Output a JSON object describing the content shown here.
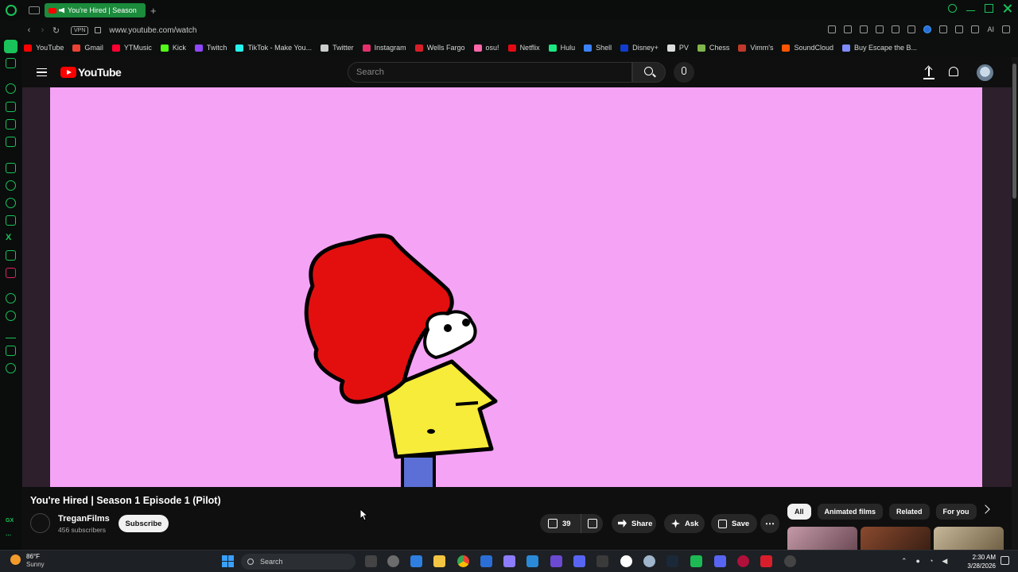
{
  "browser": {
    "tab_title": "You're Hired | Season",
    "url": "www.youtube.com/watch",
    "vpn_label": "VPN",
    "ai_label": "AI",
    "new_tab_symbol": "+"
  },
  "bookmarks": [
    {
      "label": "YouTube",
      "color": "#ff0000"
    },
    {
      "label": "Gmail",
      "color": "#ea4335"
    },
    {
      "label": "YTMusic",
      "color": "#ff0033"
    },
    {
      "label": "Kick",
      "color": "#53fc18"
    },
    {
      "label": "Twitch",
      "color": "#9146ff"
    },
    {
      "label": "TikTok - Make You...",
      "color": "#25f4ee"
    },
    {
      "label": "Twitter",
      "color": "#cccccc"
    },
    {
      "label": "Instagram",
      "color": "#e1306c"
    },
    {
      "label": "Wells Fargo",
      "color": "#d71e28"
    },
    {
      "label": "osu!",
      "color": "#ff66aa"
    },
    {
      "label": "Netflix",
      "color": "#e50914"
    },
    {
      "label": "Hulu",
      "color": "#1ce783"
    },
    {
      "label": "Shell",
      "color": "#3b82f6"
    },
    {
      "label": "Disney+",
      "color": "#113ccf"
    },
    {
      "label": "PV",
      "color": "#dddddd"
    },
    {
      "label": "Chess",
      "color": "#81b64c"
    },
    {
      "label": "Vimm's",
      "color": "#c0392b"
    },
    {
      "label": "SoundCloud",
      "color": "#ff5500"
    },
    {
      "label": "Buy Escape the B...",
      "color": "#7f8cff"
    }
  ],
  "youtube": {
    "logo_text": "YouTube",
    "search_placeholder": "Search"
  },
  "video": {
    "title": "You're Hired | Season 1 Episode 1 (Pilot)",
    "background_color": "#f5a3f5"
  },
  "channel": {
    "name": "TreganFilms",
    "subscribers": "456 subscribers",
    "subscribe_label": "Subscribe"
  },
  "actions": {
    "likes": "39",
    "share_label": "Share",
    "ask_label": "Ask",
    "save_label": "Save",
    "more_label": "⋯"
  },
  "chips": [
    "All",
    "Animated films",
    "Related",
    "For you"
  ],
  "taskbar": {
    "weather_temp": "86°F",
    "weather_cond": "Sunny",
    "search_label": "Search",
    "time": "2:30 AM",
    "date": "3/28/2026"
  }
}
